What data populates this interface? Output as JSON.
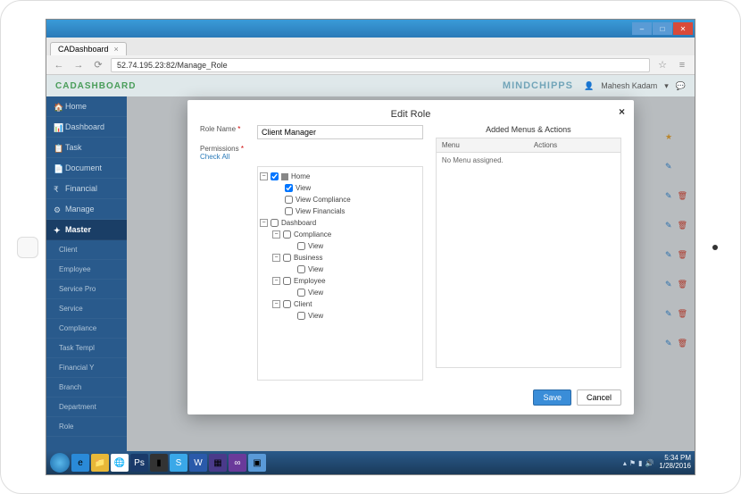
{
  "browser": {
    "tab_title": "CADashboard",
    "url": "52.74.195.23:82/Manage_Role"
  },
  "header": {
    "brand": "CADASHBOARD",
    "logo_text": "MINDCHIPPS",
    "user": "Mahesh Kadam"
  },
  "sidebar": {
    "items": [
      {
        "label": "Home"
      },
      {
        "label": "Dashboard"
      },
      {
        "label": "Task"
      },
      {
        "label": "Document"
      },
      {
        "label": "Financial"
      },
      {
        "label": "Manage"
      },
      {
        "label": "Master",
        "active": true
      },
      {
        "label": "Client",
        "sub": true
      },
      {
        "label": "Employee",
        "sub": true
      },
      {
        "label": "Service Pro",
        "sub": true
      },
      {
        "label": "Service",
        "sub": true
      },
      {
        "label": "Compliance",
        "sub": true
      },
      {
        "label": "Task Templ",
        "sub": true
      },
      {
        "label": "Financial Y",
        "sub": true
      },
      {
        "label": "Branch",
        "sub": true
      },
      {
        "label": "Department",
        "sub": true
      },
      {
        "label": "Role",
        "sub": true
      }
    ]
  },
  "modal": {
    "title": "Edit Role",
    "role_name_label": "Role Name",
    "role_name_value": "Client Manager",
    "permissions_label": "Permissions",
    "check_all": "Check All",
    "tree": {
      "home": "Home",
      "view": "View",
      "view_compliance": "View Compliance",
      "view_financials": "View Financials",
      "dashboard": "Dashboard",
      "compliance": "Compliance",
      "business": "Business",
      "employee": "Employee",
      "client": "Client"
    },
    "right_title": "Added Menus & Actions",
    "col_menu": "Menu",
    "col_actions": "Actions",
    "empty_msg": "No Menu assigned.",
    "save": "Save",
    "cancel": "Cancel"
  },
  "taskbar": {
    "time": "5:34 PM",
    "date": "1/28/2016"
  }
}
